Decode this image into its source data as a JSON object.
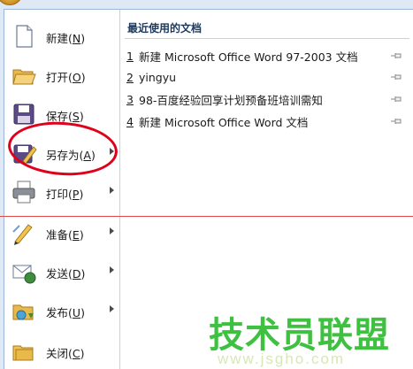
{
  "menu": {
    "commands": [
      {
        "label": "新建",
        "key": "N",
        "has_submenu": false,
        "icon": "new-document-icon"
      },
      {
        "label": "打开",
        "key": "O",
        "has_submenu": false,
        "icon": "open-folder-icon"
      },
      {
        "label": "保存",
        "key": "S",
        "has_submenu": false,
        "icon": "save-disk-icon"
      },
      {
        "label": "另存为",
        "key": "A",
        "has_submenu": true,
        "icon": "save-as-icon"
      },
      {
        "label": "打印",
        "key": "P",
        "has_submenu": true,
        "icon": "printer-icon"
      },
      {
        "label": "准备",
        "key": "E",
        "has_submenu": true,
        "icon": "prepare-pen-icon"
      },
      {
        "label": "发送",
        "key": "D",
        "has_submenu": true,
        "icon": "send-icon"
      },
      {
        "label": "发布",
        "key": "U",
        "has_submenu": true,
        "icon": "publish-icon"
      },
      {
        "label": "关闭",
        "key": "C",
        "has_submenu": false,
        "icon": "close-folder-icon"
      }
    ]
  },
  "recent": {
    "title": "最近使用的文档",
    "items": [
      {
        "num": "1",
        "name": "新建 Microsoft Office Word 97-2003 文档"
      },
      {
        "num": "2",
        "name": "yingyu"
      },
      {
        "num": "3",
        "name": "98-百度经验回享计划预备班培训需知"
      },
      {
        "num": "4",
        "name": "新建 Microsoft Office Word 文档"
      }
    ]
  },
  "watermark": {
    "text": "技术员联盟",
    "url": "www.jsgho.com"
  },
  "colors": {
    "annotation_red": "#e0001b",
    "watermark_green": "#3ec040",
    "menu_border": "#9db5d6"
  }
}
